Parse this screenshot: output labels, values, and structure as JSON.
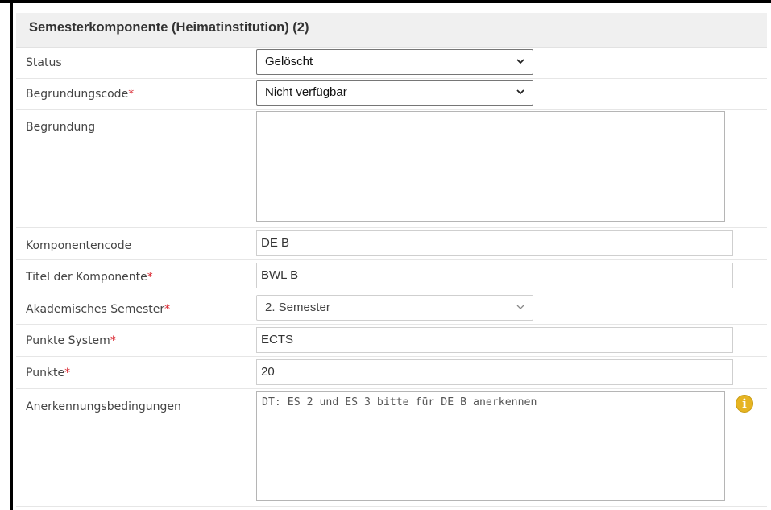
{
  "section": {
    "title": "Semesterkomponente (Heimatinstitution) (2)"
  },
  "fields": {
    "status": {
      "label": "Status",
      "value": "Gelöscht"
    },
    "begrundungscode": {
      "label": "Begrundungscode",
      "required_mark": "*",
      "value": "Nicht verfügbar"
    },
    "begrundung": {
      "label": "Begrundung",
      "value": ""
    },
    "komponentencode": {
      "label": "Komponentencode",
      "value": "DE B"
    },
    "titel": {
      "label": "Titel der Komponente",
      "required_mark": "*",
      "value": "BWL B"
    },
    "semester": {
      "label": "Akademisches Semester",
      "required_mark": "*",
      "value": "2. Semester"
    },
    "punkte_system": {
      "label": "Punkte System",
      "required_mark": "*",
      "value": "ECTS"
    },
    "punkte": {
      "label": "Punkte",
      "required_mark": "*",
      "value": "20"
    },
    "anerkennung": {
      "label": "Anerkennungsbedingungen",
      "value": "DT: ES 2 und ES 3 bitte für DE B anerkennen"
    }
  },
  "icons": {
    "info": "info-icon",
    "chevron": "chevron-down-icon"
  },
  "colors": {
    "required": "#d9232d",
    "info": "#e6b422",
    "header_bg": "#f0f0f0"
  }
}
